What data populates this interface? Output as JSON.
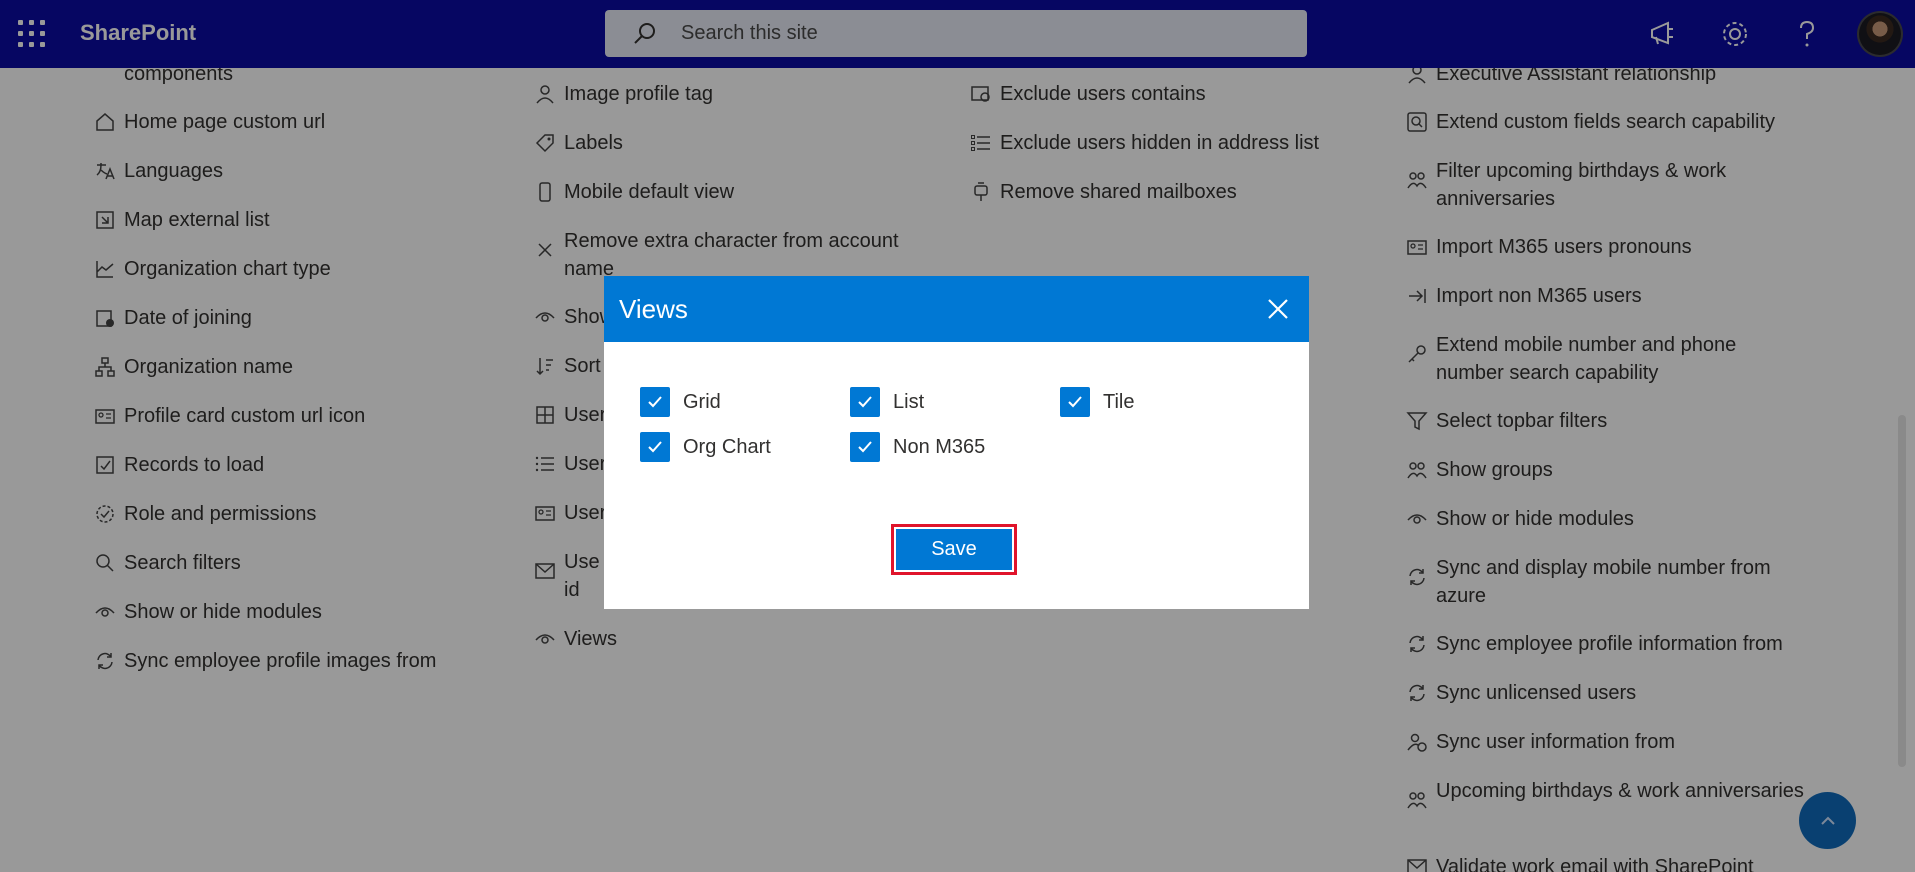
{
  "topbar": {
    "brand": "SharePoint",
    "search_placeholder": "Search this site"
  },
  "column1": {
    "items": [
      {
        "label": "components",
        "icon": "component-icon"
      },
      {
        "label": "Home page custom url",
        "icon": "home-icon"
      },
      {
        "label": "Languages",
        "icon": "translate-icon"
      },
      {
        "label": "Map external list",
        "icon": "map-icon"
      },
      {
        "label": "Organization chart type",
        "icon": "chart-icon"
      },
      {
        "label": "Date of joining",
        "icon": "calendar-icon"
      },
      {
        "label": "Organization name",
        "icon": "org-icon"
      },
      {
        "label": "Profile card custom url icon",
        "icon": "contact-card-icon"
      },
      {
        "label": "Records to load",
        "icon": "check-list-icon"
      },
      {
        "label": "Role and permissions",
        "icon": "badge-icon"
      },
      {
        "label": "Search filters",
        "icon": "search-icon"
      },
      {
        "label": "Show or hide modules",
        "icon": "eye-icon"
      },
      {
        "label": "Sync employee profile images from",
        "icon": "sync-icon"
      }
    ]
  },
  "column2": {
    "items": [
      {
        "label": "Image profile tag",
        "icon": "person-icon"
      },
      {
        "label": "Labels",
        "icon": "tag-icon"
      },
      {
        "label": "Mobile default view",
        "icon": "phone-icon"
      },
      {
        "label": "Remove extra character from account name",
        "icon": "close-icon"
      },
      {
        "label": "Show",
        "icon": "eye-icon"
      },
      {
        "label": "Sort",
        "icon": "sort-icon"
      },
      {
        "label": "User",
        "icon": "grid-icon"
      },
      {
        "label": "User",
        "icon": "list-icon"
      },
      {
        "label": "User",
        "icon": "contact-card-icon"
      },
      {
        "label": "Use",
        "icon": "mail-icon"
      },
      {
        "label": "id",
        "icon": ""
      },
      {
        "label": "Views",
        "icon": "eye-icon"
      }
    ]
  },
  "column3": {
    "items": [
      {
        "label": "Exclude users contains",
        "icon": "filter-person-icon"
      },
      {
        "label": "Exclude users hidden in address list",
        "icon": "list-icon"
      },
      {
        "label": "Remove shared mailboxes",
        "icon": "mailbox-icon"
      }
    ]
  },
  "column4": {
    "items": [
      {
        "label": "Executive Assistant relationship",
        "icon": "person-icon"
      },
      {
        "label": "Extend custom fields search capability",
        "icon": "search-box-icon"
      },
      {
        "label": "Filter upcoming birthdays & work anniversaries",
        "icon": "people-icon"
      },
      {
        "label": "Import M365 users pronouns",
        "icon": "contact-card-icon"
      },
      {
        "label": "Import non M365 users",
        "icon": "import-icon"
      },
      {
        "label": "Extend mobile number and phone number search capability",
        "icon": "key-icon"
      },
      {
        "label": "Select topbar filters",
        "icon": "filter-icon"
      },
      {
        "label": "Show groups",
        "icon": "people-icon"
      },
      {
        "label": "Show or hide modules",
        "icon": "eye-icon"
      },
      {
        "label": "Sync and display mobile number from azure",
        "icon": "sync-icon"
      },
      {
        "label": "Sync employee profile information from",
        "icon": "sync-icon"
      },
      {
        "label": "Sync unlicensed users",
        "icon": "sync-icon"
      },
      {
        "label": "Sync user information from",
        "icon": "people-sync-icon"
      },
      {
        "label": "Upcoming birthdays & work anniversaries",
        "icon": "people-icon"
      },
      {
        "label": "Validate work email with SharePoint",
        "icon": "mail-icon"
      }
    ]
  },
  "dialog": {
    "title": "Views",
    "options": [
      {
        "label": "Grid",
        "checked": true
      },
      {
        "label": "List",
        "checked": true
      },
      {
        "label": "Tile",
        "checked": true
      },
      {
        "label": "Org Chart",
        "checked": true
      },
      {
        "label": "Non M365",
        "checked": true
      }
    ],
    "save_label": "Save"
  },
  "colors": {
    "suite_bar": "#0A0BA3",
    "accent": "#0078D4",
    "highlight": "#E0142B"
  }
}
